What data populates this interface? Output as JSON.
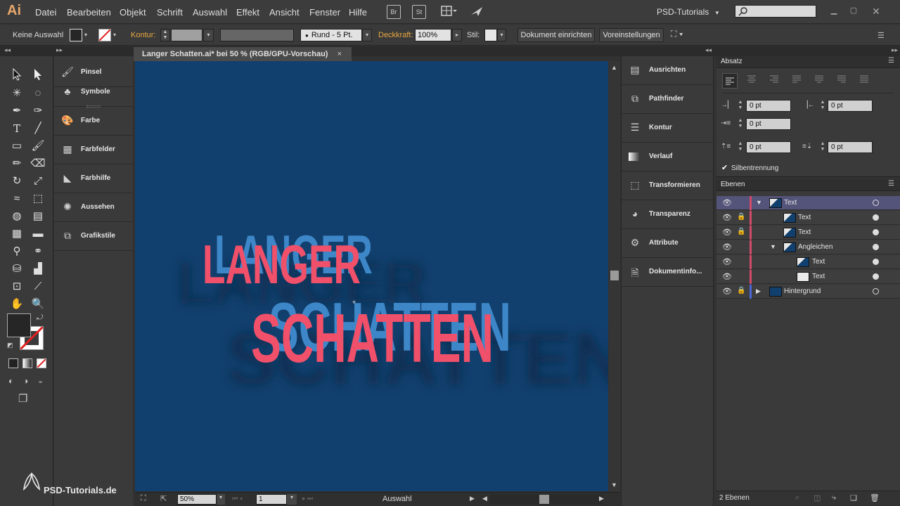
{
  "app": {
    "logo": "Ai",
    "menu": [
      "Datei",
      "Bearbeiten",
      "Objekt",
      "Schrift",
      "Auswahl",
      "Effekt",
      "Ansicht",
      "Fenster",
      "Hilfe"
    ],
    "bridge_label": "Br",
    "stock_label": "St",
    "workspace": "PSD-Tutorials",
    "workspace_caret": "▾"
  },
  "controlbar": {
    "selection": "Keine Auswahl",
    "stroke_label": "Kontur:",
    "brush": "Rund - 5 Pt.",
    "opacity_label": "Deckkraft:",
    "opacity_value": "100%",
    "style_label": "Stil:",
    "doc_setup": "Dokument einrichten",
    "preferences": "Voreinstellungen"
  },
  "document": {
    "tab_title": "Langer Schatten.ai* bei 50 % (RGB/GPU-Vorschau)",
    "close": "×",
    "artwork_line1": "LANGER",
    "artwork_line2": "SCHATTEN",
    "colors": {
      "canvas": "#12406e",
      "text": "#f05069",
      "shadow_text": "#3d87c8",
      "long_shadow": "#0c2f52"
    }
  },
  "statusbar": {
    "zoom": "50%",
    "artboard": "1",
    "mode": "Auswahl"
  },
  "left_panels": [
    "Pinsel",
    "Symbole",
    "Farbe",
    "Farbfelder",
    "Farbhilfe",
    "Aussehen",
    "Grafikstile"
  ],
  "right_panels": [
    "Ausrichten",
    "Pathfinder",
    "Kontur",
    "Verlauf",
    "Transformieren",
    "Transparenz",
    "Attribute",
    "Dokumentinfo..."
  ],
  "absatz": {
    "title": "Absatz",
    "left_indent": "0 pt",
    "right_indent": "0 pt",
    "first_line_indent": "0 pt",
    "space_before": "0 pt",
    "space_after": "0 pt",
    "hyphenation": "Silbentrennung"
  },
  "ebenen": {
    "title": "Ebenen",
    "count": "2 Ebenen",
    "layers": [
      {
        "name": "Text",
        "indent": 0,
        "arrow": "▼",
        "selected": true,
        "locked": false,
        "white": false
      },
      {
        "name": "Text",
        "indent": 1,
        "arrow": "",
        "selected": false,
        "locked": true,
        "white": false
      },
      {
        "name": "Text",
        "indent": 1,
        "arrow": "",
        "selected": false,
        "locked": true,
        "white": false
      },
      {
        "name": "Angleichen",
        "indent": 1,
        "arrow": "▼",
        "selected": false,
        "locked": false,
        "white": false
      },
      {
        "name": "Text",
        "indent": 2,
        "arrow": "",
        "selected": false,
        "locked": false,
        "white": false
      },
      {
        "name": "Text",
        "indent": 2,
        "arrow": "",
        "selected": false,
        "locked": false,
        "white": true
      },
      {
        "name": "Hintergrund",
        "indent": 0,
        "arrow": "▶",
        "selected": false,
        "locked": true,
        "white": false
      }
    ]
  },
  "watermark": "PSD-Tutorials.de"
}
